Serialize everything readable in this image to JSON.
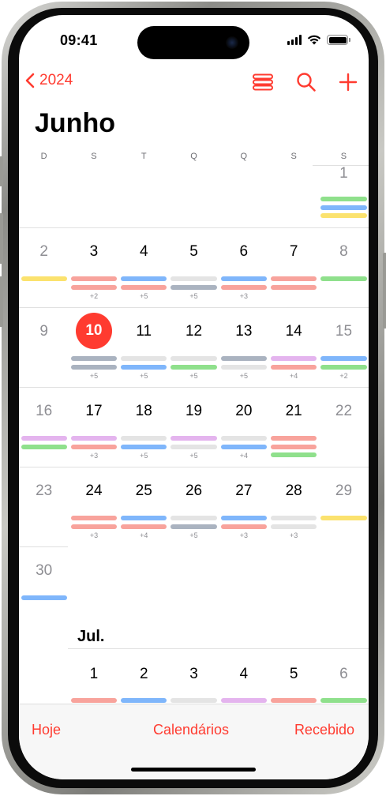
{
  "status": {
    "time": "09:41"
  },
  "nav": {
    "year": "2024"
  },
  "month": {
    "title": "Junho",
    "next_title": "Jul."
  },
  "weekdays": [
    "D",
    "S",
    "T",
    "Q",
    "Q",
    "S",
    "S"
  ],
  "colors": {
    "accent": "#ff3b30",
    "red": "#f8a39c",
    "blue": "#7fb6fb",
    "gray": "#e4e4e4",
    "slate": "#aab3c0",
    "green": "#8fe08c",
    "purple": "#e4b4ee",
    "yellow": "#fbe26e"
  },
  "weeks": [
    {
      "days": [
        {
          "col": 6,
          "num": "1",
          "weekend": true,
          "bars": [
            "green",
            "blue",
            "yellow"
          ],
          "more": ""
        }
      ]
    },
    {
      "days": [
        {
          "col": 0,
          "num": "2",
          "weekend": true,
          "bars": [
            "yellow"
          ],
          "more": ""
        },
        {
          "col": 1,
          "num": "3",
          "bars": [
            "red",
            "red"
          ],
          "more": "+2"
        },
        {
          "col": 2,
          "num": "4",
          "bars": [
            "blue",
            "red"
          ],
          "more": "+5"
        },
        {
          "col": 3,
          "num": "5",
          "bars": [
            "gray",
            "slate"
          ],
          "more": "+5"
        },
        {
          "col": 4,
          "num": "6",
          "bars": [
            "blue",
            "red"
          ],
          "more": "+3"
        },
        {
          "col": 5,
          "num": "7",
          "bars": [
            "red",
            "red"
          ],
          "more": ""
        },
        {
          "col": 6,
          "num": "8",
          "weekend": true,
          "bars": [
            "green"
          ],
          "more": ""
        }
      ]
    },
    {
      "days": [
        {
          "col": 0,
          "num": "9",
          "weekend": true,
          "bars": [],
          "more": ""
        },
        {
          "col": 1,
          "num": "10",
          "today": true,
          "bars": [
            "slate",
            "slate"
          ],
          "more": "+5"
        },
        {
          "col": 2,
          "num": "11",
          "bars": [
            "gray",
            "blue"
          ],
          "more": "+5"
        },
        {
          "col": 3,
          "num": "12",
          "bars": [
            "gray",
            "green"
          ],
          "more": "+5"
        },
        {
          "col": 4,
          "num": "13",
          "bars": [
            "slate",
            "gray"
          ],
          "more": "+5"
        },
        {
          "col": 5,
          "num": "14",
          "bars": [
            "purple",
            "red"
          ],
          "more": "+4"
        },
        {
          "col": 6,
          "num": "15",
          "weekend": true,
          "bars": [
            "blue",
            "green"
          ],
          "more": "+2"
        }
      ]
    },
    {
      "days": [
        {
          "col": 0,
          "num": "16",
          "weekend": true,
          "bars": [
            "purple",
            "green"
          ],
          "more": ""
        },
        {
          "col": 1,
          "num": "17",
          "bars": [
            "purple",
            "red"
          ],
          "more": "+3"
        },
        {
          "col": 2,
          "num": "18",
          "bars": [
            "gray",
            "blue"
          ],
          "more": "+5"
        },
        {
          "col": 3,
          "num": "19",
          "bars": [
            "purple",
            "gray"
          ],
          "more": "+5"
        },
        {
          "col": 4,
          "num": "20",
          "bars": [
            "gray",
            "blue"
          ],
          "more": "+4"
        },
        {
          "col": 5,
          "num": "21",
          "bars": [
            "red",
            "red",
            "green"
          ],
          "more": ""
        },
        {
          "col": 6,
          "num": "22",
          "weekend": true,
          "bars": [],
          "more": ""
        }
      ]
    },
    {
      "days": [
        {
          "col": 0,
          "num": "23",
          "weekend": true,
          "bars": [],
          "more": ""
        },
        {
          "col": 1,
          "num": "24",
          "bars": [
            "red",
            "red"
          ],
          "more": "+3"
        },
        {
          "col": 2,
          "num": "25",
          "bars": [
            "blue",
            "red"
          ],
          "more": "+4"
        },
        {
          "col": 3,
          "num": "26",
          "bars": [
            "gray",
            "slate"
          ],
          "more": "+5"
        },
        {
          "col": 4,
          "num": "27",
          "bars": [
            "blue",
            "red"
          ],
          "more": "+3"
        },
        {
          "col": 5,
          "num": "28",
          "bars": [
            "gray",
            "gray"
          ],
          "more": "+3"
        },
        {
          "col": 6,
          "num": "29",
          "weekend": true,
          "bars": [
            "yellow"
          ],
          "more": ""
        }
      ]
    },
    {
      "days": [
        {
          "col": 0,
          "num": "30",
          "weekend": true,
          "bars": [
            "blue"
          ],
          "more": ""
        }
      ]
    }
  ],
  "july": {
    "days": [
      {
        "col": 1,
        "num": "1",
        "bars": [
          "red"
        ]
      },
      {
        "col": 2,
        "num": "2",
        "bars": [
          "blue"
        ]
      },
      {
        "col": 3,
        "num": "3",
        "bars": [
          "gray"
        ]
      },
      {
        "col": 4,
        "num": "4",
        "bars": [
          "purple"
        ]
      },
      {
        "col": 5,
        "num": "5",
        "bars": [
          "red"
        ]
      },
      {
        "col": 6,
        "num": "6",
        "weekend": true,
        "bars": [
          "green"
        ]
      }
    ]
  },
  "toolbar": {
    "today": "Hoje",
    "calendars": "Calendários",
    "inbox": "Recebido"
  },
  "icons": {
    "back": "chevron-left-icon",
    "list": "list-view-icon",
    "search": "search-icon",
    "add": "plus-icon"
  }
}
